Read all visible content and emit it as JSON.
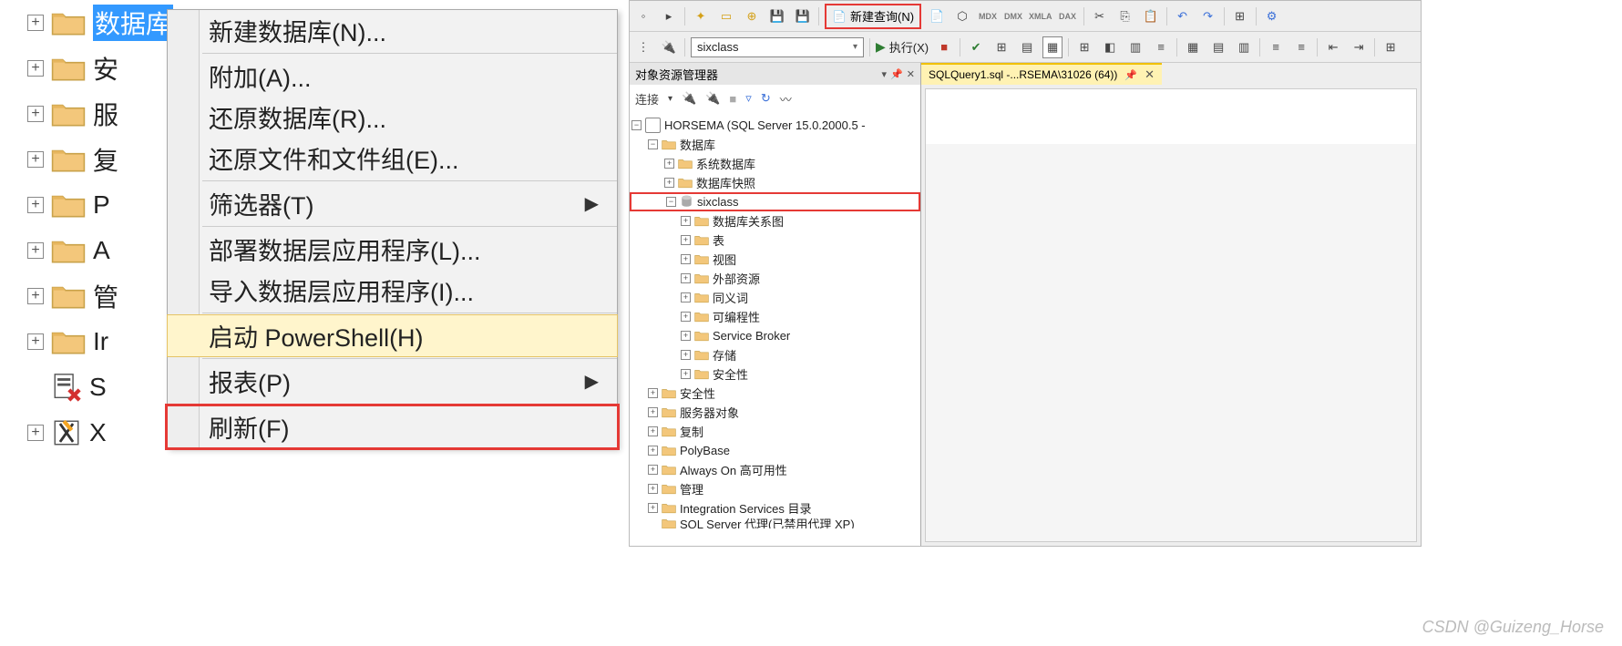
{
  "left_tree": {
    "items": [
      {
        "label": "数据库",
        "selected": true
      },
      {
        "label": "安"
      },
      {
        "label": "服"
      },
      {
        "label": "复"
      },
      {
        "label": "P"
      },
      {
        "label": "A"
      },
      {
        "label": "管"
      },
      {
        "label": "Ir"
      },
      {
        "label": "S",
        "icon": "sql-error"
      },
      {
        "label": "X",
        "icon": "xevent"
      }
    ]
  },
  "context_menu": {
    "items": [
      {
        "label": "新建数据库(N)..."
      },
      {
        "sep": true
      },
      {
        "label": "附加(A)..."
      },
      {
        "label": "还原数据库(R)..."
      },
      {
        "label": "还原文件和文件组(E)..."
      },
      {
        "sep": true
      },
      {
        "label": "筛选器(T)",
        "arrow": true
      },
      {
        "sep": true
      },
      {
        "label": "部署数据层应用程序(L)..."
      },
      {
        "label": "导入数据层应用程序(I)..."
      },
      {
        "sep": true
      },
      {
        "label": "启动 PowerShell(H)",
        "highlighted": true
      },
      {
        "sep": true
      },
      {
        "label": "报表(P)",
        "arrow": true
      },
      {
        "sep": true
      },
      {
        "label": "刷新(F)",
        "redbox": true
      }
    ]
  },
  "toolbar": {
    "new_query": "新建查询(N)",
    "tiny_labels": [
      "MDX",
      "DMX",
      "XMLA",
      "DAX"
    ],
    "database_combo": "sixclass",
    "execute": "执行(X)"
  },
  "object_explorer": {
    "title": "对象资源管理器",
    "connect": "连接",
    "server": "HORSEMA (SQL Server 15.0.2000.5 -",
    "db_root": "数据库",
    "children": [
      "系统数据库",
      "数据库快照"
    ],
    "active_db": "sixclass",
    "db_children": [
      "数据库关系图",
      "表",
      "视图",
      "外部资源",
      "同义词",
      "可编程性",
      "Service Broker",
      "存储",
      "安全性"
    ],
    "server_folders": [
      "安全性",
      "服务器对象",
      "复制",
      "PolyBase",
      "Always On 高可用性",
      "管理",
      "Integration Services 目录"
    ],
    "agent_cut": "SQL Server 代理(已禁用代理 XP)"
  },
  "tab": {
    "title": "SQLQuery1.sql -...RSEMA\\31026 (64))"
  },
  "watermark": "CSDN @Guizeng_Horse"
}
